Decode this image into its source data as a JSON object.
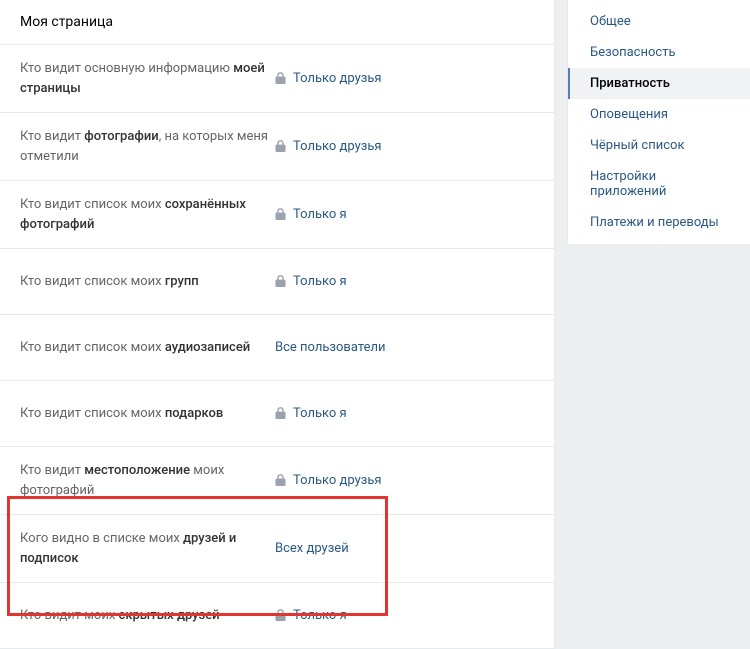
{
  "section_title": "Моя страница",
  "settings": [
    {
      "label_plain": "Кто видит основную информацию ",
      "label_bold": "моей страницы",
      "value": "Только друзья",
      "locked": true
    },
    {
      "label_plain": "Кто видит ",
      "label_bold": "фотографии",
      "label_after": ", на которых меня отметили",
      "value": "Только друзья",
      "locked": true
    },
    {
      "label_plain": "Кто видит список моих ",
      "label_bold": "сохранённых фотографий",
      "value": "Только я",
      "locked": true
    },
    {
      "label_plain": "Кто видит список моих ",
      "label_bold": "групп",
      "value": "Только я",
      "locked": true
    },
    {
      "label_plain": "Кто видит список моих ",
      "label_bold": "аудиозаписей",
      "value": "Все пользователи",
      "locked": false
    },
    {
      "label_plain": "Кто видит список моих ",
      "label_bold": "подарков",
      "value": "Только я",
      "locked": true
    },
    {
      "label_plain": "Кто видит ",
      "label_bold": "местоположение",
      "label_after": " моих фотографий",
      "value": "Только друзья",
      "locked": true
    },
    {
      "label_plain": "Кого видно в списке моих ",
      "label_bold": "друзей и подписок",
      "value": "Всех друзей",
      "locked": false
    },
    {
      "label_plain": "Кто видит моих ",
      "label_bold": "скрытых друзей",
      "value": "Только я",
      "locked": true
    }
  ],
  "nav": [
    {
      "label": "Общее",
      "active": false
    },
    {
      "label": "Безопасность",
      "active": false
    },
    {
      "label": "Приватность",
      "active": true
    },
    {
      "label": "Оповещения",
      "active": false
    },
    {
      "label": "Чёрный список",
      "active": false
    },
    {
      "label": "Настройки приложений",
      "active": false
    },
    {
      "label": "Платежи и переводы",
      "active": false
    }
  ]
}
